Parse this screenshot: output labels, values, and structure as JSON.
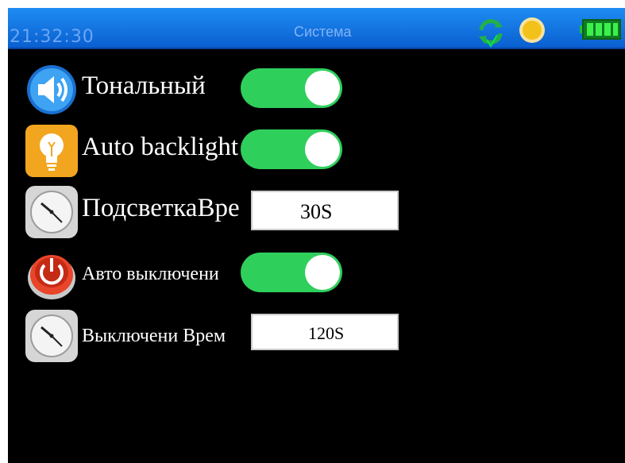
{
  "status": {
    "time": "21:32:30",
    "title": "Система",
    "icons": [
      "sync-check-icon",
      "sun-icon",
      "battery-icon"
    ]
  },
  "settings": [
    {
      "label": "Тональный",
      "control": "toggle",
      "state": "on",
      "icon": "speaker-icon"
    },
    {
      "label": "Auto backlight",
      "control": "toggle",
      "state": "on",
      "icon": "lightbulb-icon"
    },
    {
      "label": "ПодсветкаВре",
      "control": "value",
      "value": "30S",
      "icon": "clock-icon"
    },
    {
      "label": "Авто выключени",
      "control": "toggle",
      "state": "on",
      "icon": "power-icon"
    },
    {
      "label": "Выключени Врем",
      "control": "value",
      "value": "120S",
      "icon": "clock-icon"
    }
  ],
  "colors": {
    "statusbar": "#1478e8",
    "toggle_on": "#2fcf5c",
    "background": "#000000"
  }
}
